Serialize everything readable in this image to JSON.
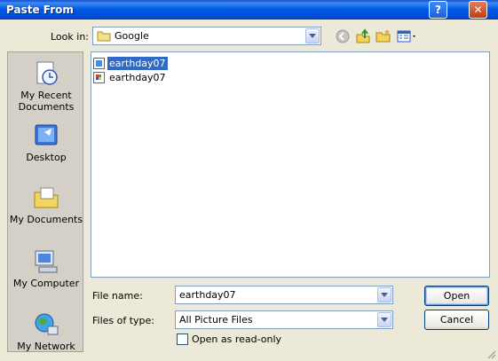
{
  "window": {
    "title": "Paste From",
    "help_label": "?",
    "close_label": "✕"
  },
  "lookin": {
    "label": "Look in:",
    "value": "Google"
  },
  "toolbar": {
    "back_icon": "back-icon",
    "up_icon": "up-folder-icon",
    "new_folder_icon": "new-folder-icon",
    "views_icon": "views-menu-icon"
  },
  "places": [
    {
      "label": "My Recent\nDocuments",
      "icon": "recent-documents-icon"
    },
    {
      "label": "Desktop",
      "icon": "desktop-icon"
    },
    {
      "label": "My Documents",
      "icon": "my-documents-icon"
    },
    {
      "label": "My Computer",
      "icon": "my-computer-icon"
    },
    {
      "label": "My Network",
      "icon": "my-network-icon"
    }
  ],
  "files": [
    {
      "name": "earthday07",
      "selected": true,
      "icon": "image-file-icon"
    },
    {
      "name": "earthday07",
      "selected": false,
      "icon": "image-file-icon"
    }
  ],
  "filename": {
    "label": "File name:",
    "value": "earthday07"
  },
  "filetype": {
    "label": "Files of type:",
    "value": "All Picture Files"
  },
  "readonly": {
    "label": "Open as read-only",
    "checked": false
  },
  "buttons": {
    "open": "Open",
    "cancel": "Cancel"
  },
  "colors": {
    "titlebar": "#0058e6",
    "dialog_bg": "#ece9d8",
    "selection": "#316ac5"
  }
}
